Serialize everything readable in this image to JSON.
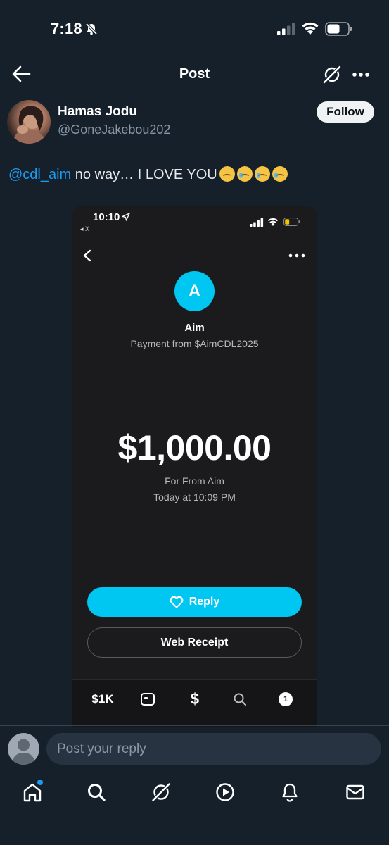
{
  "status_bar": {
    "time": "7:18"
  },
  "header": {
    "title": "Post"
  },
  "post": {
    "author_name": "Hamas Jodu",
    "author_handle": "@GoneJakebou202",
    "follow_label": "Follow",
    "mention": "@cdl_aim",
    "text": " no way… I LOVE YOU",
    "emojis": [
      "pleading-face",
      "crying-face",
      "crying-face",
      "crying-face"
    ]
  },
  "embedded_screenshot": {
    "time": "10:10",
    "back_app": "◂ X",
    "avatar_letter": "A",
    "payer_name": "Aim",
    "payment_from": "Payment from $AimCDL2025",
    "amount": "$1,000.00",
    "note": "For From Aim",
    "date": "Today at 10:09 PM",
    "reply_label": "Reply",
    "web_receipt_label": "Web Receipt",
    "tabs": {
      "balance": "$1K",
      "pay": "$",
      "activity_badge": "1"
    },
    "accent_color": "#00c6f2"
  },
  "reply_bar": {
    "placeholder": "Post your reply"
  },
  "colors": {
    "background": "#15202b",
    "link": "#1d9bf0"
  }
}
